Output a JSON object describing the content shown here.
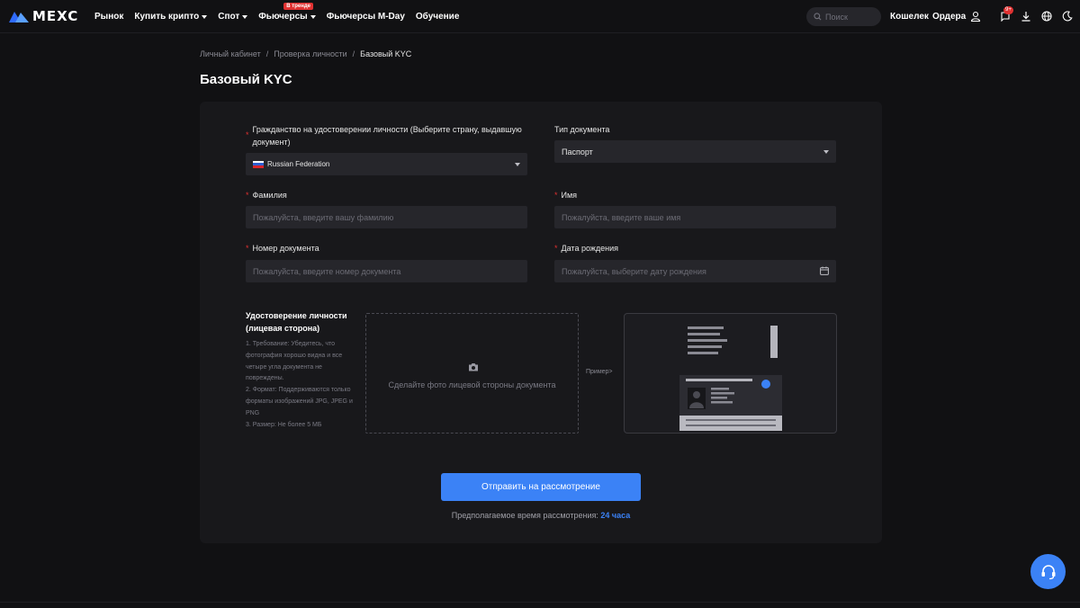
{
  "header": {
    "logo_text": "MEXC",
    "nav": [
      {
        "label": "Рынок",
        "dropdown": false
      },
      {
        "label": "Купить крипто",
        "dropdown": true
      },
      {
        "label": "Спот",
        "dropdown": true
      },
      {
        "label": "Фьючерсы",
        "dropdown": true,
        "badge": "В тренде"
      },
      {
        "label": "Фьючерсы M-Day",
        "dropdown": false
      },
      {
        "label": "Обучение",
        "dropdown": false
      }
    ],
    "search_placeholder": "Поиск",
    "wallet": "Кошелек",
    "orders": "Ордера",
    "notif_count": "9+",
    "icons": [
      "user-icon",
      "bell-icon",
      "download-icon",
      "globe-icon",
      "moon-icon"
    ]
  },
  "breadcrumb": [
    "Личный кабинет",
    "Проверка личности",
    "Базовый KYC"
  ],
  "page_title": "Базовый KYC",
  "form": {
    "citizenship_label": "Гражданство на удостоверении личности (Выберите страну, выдавшую документ)",
    "citizenship_value": "Russian Federation",
    "doc_type_label": "Тип документа",
    "doc_type_value": "Паспорт",
    "last_name_label": "Фамилия",
    "last_name_placeholder": "Пожалуйста, введите вашу фамилию",
    "first_name_label": "Имя",
    "first_name_placeholder": "Пожалуйста, введите ваше имя",
    "doc_number_label": "Номер документа",
    "doc_number_placeholder": "Пожалуйста, введите номер документа",
    "birth_date_label": "Дата рождения",
    "birth_date_placeholder": "Пожалуйста, выберите дату рождения",
    "required_mark": "*"
  },
  "upload": {
    "title": "Удостоверение личности (лицевая сторона)",
    "req1": "1. Требование: Убедитесь, что фотография хорошо видна и все четыре угла документа не повреждены.",
    "req2": "2. Формат: Поддерживаются только форматы изображений JPG, JPEG и PNG",
    "req3": "3. Размер: Не более 5 МБ",
    "hint": "Сделайте фото лицевой стороны документа",
    "example_link": "Пример>"
  },
  "submit_label": "Отправить на рассмотрение",
  "review_prefix": "Предполагаемое время рассмотрения:",
  "review_time": "24 часа",
  "colors": {
    "accent": "#3b82f6",
    "required": "#e03131",
    "background": "#111113",
    "card": "#18181b"
  }
}
